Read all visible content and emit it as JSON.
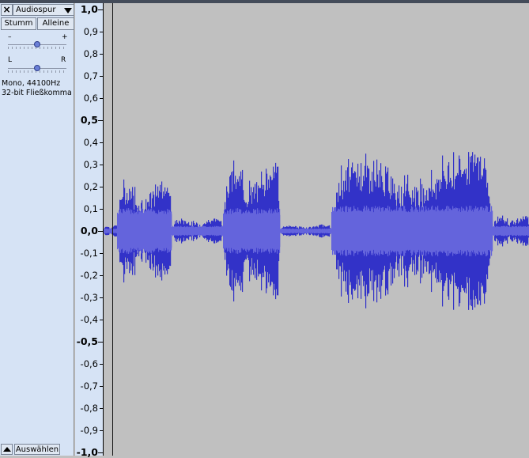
{
  "track": {
    "close_label": "×",
    "name": "Audiospur",
    "mute_label": "Stumm",
    "solo_label": "Alleine",
    "gain": {
      "minus_label": "–",
      "plus_label": "+",
      "value_fraction": 0.5
    },
    "pan": {
      "left_label": "L",
      "right_label": "R",
      "value_fraction": 0.5
    },
    "info_line1": "Mono, 44100Hz",
    "info_line2": "32-bit Fließkomma",
    "select_label": "Auswählen"
  },
  "ruler": {
    "ticks": [
      {
        "label": "1,0",
        "value": 1.0,
        "major": true
      },
      {
        "label": "0,9",
        "value": 0.9,
        "major": false
      },
      {
        "label": "0,8",
        "value": 0.8,
        "major": false
      },
      {
        "label": "0,7",
        "value": 0.7,
        "major": false
      },
      {
        "label": "0,6",
        "value": 0.6,
        "major": false
      },
      {
        "label": "0,5",
        "value": 0.5,
        "major": true
      },
      {
        "label": "0,4",
        "value": 0.4,
        "major": false
      },
      {
        "label": "0,3",
        "value": 0.3,
        "major": false
      },
      {
        "label": "0,2",
        "value": 0.2,
        "major": false
      },
      {
        "label": "0,1",
        "value": 0.1,
        "major": false
      },
      {
        "label": "0,0",
        "value": 0.0,
        "major": true
      },
      {
        "label": "-0,1",
        "value": -0.1,
        "major": false
      },
      {
        "label": "-0,2",
        "value": -0.2,
        "major": false
      },
      {
        "label": "-0,3",
        "value": -0.3,
        "major": false
      },
      {
        "label": "-0,4",
        "value": -0.4,
        "major": false
      },
      {
        "label": "-0,5",
        "value": -0.5,
        "major": true
      },
      {
        "label": "-0,6",
        "value": -0.6,
        "major": false
      },
      {
        "label": "-0,7",
        "value": -0.7,
        "major": false
      },
      {
        "label": "-0,8",
        "value": -0.8,
        "major": false
      },
      {
        "label": "-0,9",
        "value": -0.9,
        "major": false
      },
      {
        "label": "-1,0",
        "value": -1.0,
        "major": true
      }
    ]
  },
  "waveform": {
    "peak_color": "#3232c8",
    "rms_color": "#6464dc",
    "background_color": "#c0c0c0",
    "segments": [
      {
        "start": 0.0,
        "end": 0.031,
        "peak": 0.02,
        "rms": 0.01
      },
      {
        "start": 0.031,
        "end": 0.16,
        "peak": 0.16,
        "rms": 0.09
      },
      {
        "start": 0.16,
        "end": 0.28,
        "peak": 0.04,
        "rms": 0.02
      },
      {
        "start": 0.28,
        "end": 0.415,
        "peak": 0.22,
        "rms": 0.09
      },
      {
        "start": 0.415,
        "end": 0.535,
        "peak": 0.02,
        "rms": 0.01
      },
      {
        "start": 0.535,
        "end": 0.915,
        "peak": 0.24,
        "rms": 0.1
      },
      {
        "start": 0.915,
        "end": 1.0,
        "peak": 0.05,
        "rms": 0.02
      }
    ]
  }
}
